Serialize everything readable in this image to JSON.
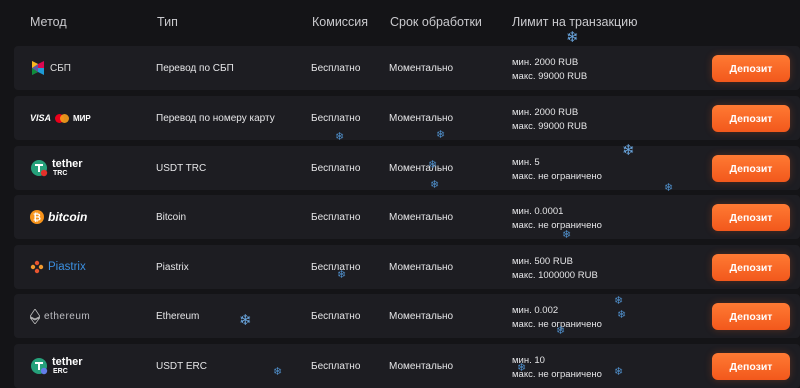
{
  "header": {
    "method": "Метод",
    "type": "Тип",
    "fee": "Комиссия",
    "time": "Срок обработки",
    "limit": "Лимит на транзакцию"
  },
  "rows": [
    {
      "logo": "sbp-logo",
      "logo_text": "СБП",
      "type": "Перевод по СБП",
      "fee": "Бесплатно",
      "time": "Моментально",
      "limit_min": "мин. 2000 RUB",
      "limit_max": "макс. 99000 RUB",
      "button": "Депозит"
    },
    {
      "logo": "visa-mastercard-mir-logo",
      "logo_text": "VISA MИР",
      "type": "Перевод по номеру карту",
      "fee": "Бесплатно",
      "time": "Моментально",
      "limit_min": "мин. 2000 RUB",
      "limit_max": "макс. 99000 RUB",
      "button": "Депозит"
    },
    {
      "logo": "tether-trc-logo",
      "logo_text": "tether",
      "logo_sub": "TRC",
      "type": "USDT TRC",
      "fee": "Бесплатно",
      "time": "Моментально",
      "limit_min": "мин. 5",
      "limit_max": "макс. не ограничено",
      "button": "Депозит"
    },
    {
      "logo": "bitcoin-logo",
      "logo_text": "bitcoin",
      "type": "Bitcoin",
      "fee": "Бесплатно",
      "time": "Моментально",
      "limit_min": "мин. 0.0001",
      "limit_max": "макс. не ограничено",
      "button": "Депозит"
    },
    {
      "logo": "piastrix-logo",
      "logo_text": "Piastrix",
      "type": "Piastrix",
      "fee": "Бесплатно",
      "time": "Моментально",
      "limit_min": "мин. 500 RUB",
      "limit_max": "макс. 1000000 RUB",
      "button": "Депозит"
    },
    {
      "logo": "ethereum-logo",
      "logo_text": "ethereum",
      "type": "Ethereum",
      "fee": "Бесплатно",
      "time": "Моментально",
      "limit_min": "мин. 0.002",
      "limit_max": "макс. не ограничено",
      "button": "Депозит"
    },
    {
      "logo": "tether-erc-logo",
      "logo_text": "tether",
      "logo_sub": "ERC",
      "type": "USDT ERC",
      "fee": "Бесплатно",
      "time": "Моментально",
      "limit_min": "мин. 10",
      "limit_max": "макс. не ограничено",
      "button": "Депозит"
    }
  ],
  "colors": {
    "accent": "#f2581c",
    "row_bg": "#1d1d22",
    "page_bg": "#141417",
    "snowflake": "#4f8ec9"
  }
}
